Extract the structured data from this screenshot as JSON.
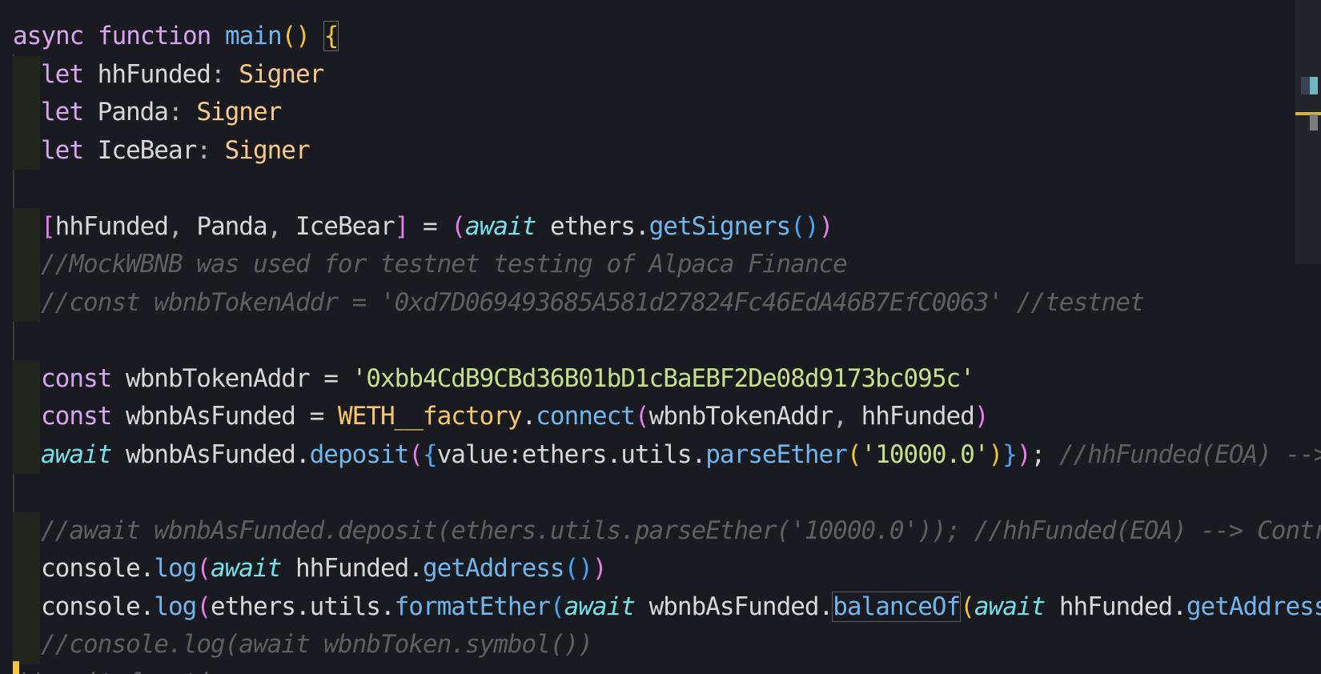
{
  "lines": [
    {
      "segments": [
        {
          "t": "async ",
          "c": "kw"
        },
        {
          "t": "function ",
          "c": "kw"
        },
        {
          "t": "main",
          "c": "fn"
        },
        {
          "t": "() ",
          "c": "b1"
        },
        {
          "t": "{",
          "c": "b1",
          "box": true
        }
      ]
    },
    {
      "ind": true,
      "segments": [
        {
          "t": "let ",
          "c": "kw"
        },
        {
          "t": "hhFunded",
          "c": "pl"
        },
        {
          "t": ": ",
          "c": "pm"
        },
        {
          "t": "Signer",
          "c": "ty"
        }
      ]
    },
    {
      "ind": true,
      "segments": [
        {
          "t": "let ",
          "c": "kw"
        },
        {
          "t": "Panda",
          "c": "pl"
        },
        {
          "t": ": ",
          "c": "pm"
        },
        {
          "t": "Signer",
          "c": "ty"
        }
      ]
    },
    {
      "ind": true,
      "segments": [
        {
          "t": "let ",
          "c": "kw"
        },
        {
          "t": "IceBear",
          "c": "pl"
        },
        {
          "t": ": ",
          "c": "pm"
        },
        {
          "t": "Signer",
          "c": "ty"
        }
      ]
    },
    {
      "blank": true,
      "segments": []
    },
    {
      "ind": true,
      "segments": [
        {
          "t": "[",
          "c": "b2"
        },
        {
          "t": "hhFunded",
          "c": "pl"
        },
        {
          "t": ", ",
          "c": "pm"
        },
        {
          "t": "Panda",
          "c": "pl"
        },
        {
          "t": ", ",
          "c": "pm"
        },
        {
          "t": "IceBear",
          "c": "pl"
        },
        {
          "t": "]",
          "c": "b2"
        },
        {
          "t": " = ",
          "c": "pl"
        },
        {
          "t": "(",
          "c": "b2"
        },
        {
          "t": "await",
          "c": "it"
        },
        {
          "t": " ethers.",
          "c": "pl"
        },
        {
          "t": "getSigners",
          "c": "fn"
        },
        {
          "t": "()",
          "c": "b3"
        },
        {
          "t": ")",
          "c": "b2"
        }
      ]
    },
    {
      "ind": true,
      "segments": [
        {
          "t": "//MockWBNB was used for testnet testing of Alpaca Finance",
          "c": "cm"
        }
      ]
    },
    {
      "ind": true,
      "segments": [
        {
          "t": "//const wbnbTokenAddr = '0xd7D069493685A581d27824Fc46EdA46B7EfC0063' //testnet",
          "c": "cm"
        }
      ]
    },
    {
      "blank": true,
      "segments": []
    },
    {
      "ind": true,
      "segments": [
        {
          "t": "const ",
          "c": "kw"
        },
        {
          "t": "wbnbTokenAddr",
          "c": "pl"
        },
        {
          "t": " = ",
          "c": "pl"
        },
        {
          "t": "'0xbb4CdB9CBd36B01bD1cBaEBF2De08d9173bc095c'",
          "c": "st"
        }
      ]
    },
    {
      "ind": true,
      "segments": [
        {
          "t": "const ",
          "c": "kw"
        },
        {
          "t": "wbnbAsFunded",
          "c": "pl"
        },
        {
          "t": " = ",
          "c": "pl"
        },
        {
          "t": "WETH__factory",
          "c": "cl"
        },
        {
          "t": ".",
          "c": "pl"
        },
        {
          "t": "connect",
          "c": "fn"
        },
        {
          "t": "(",
          "c": "b2"
        },
        {
          "t": "wbnbTokenAddr",
          "c": "pl"
        },
        {
          "t": ", ",
          "c": "pm"
        },
        {
          "t": "hhFunded",
          "c": "pl"
        },
        {
          "t": ")",
          "c": "b2"
        }
      ]
    },
    {
      "ind": true,
      "segments": [
        {
          "t": "await",
          "c": "it"
        },
        {
          "t": " wbnbAsFunded.",
          "c": "pl"
        },
        {
          "t": "deposit",
          "c": "fn"
        },
        {
          "t": "(",
          "c": "b2"
        },
        {
          "t": "{",
          "c": "b3"
        },
        {
          "t": "value:ethers.utils.",
          "c": "pl"
        },
        {
          "t": "parseEther",
          "c": "fn"
        },
        {
          "t": "(",
          "c": "b1"
        },
        {
          "t": "'10000.0'",
          "c": "st"
        },
        {
          "t": ")",
          "c": "b1"
        },
        {
          "t": "}",
          "c": "b3"
        },
        {
          "t": ")",
          "c": "b2"
        },
        {
          "t": "; ",
          "c": "pl"
        },
        {
          "t": "//hhFunded(EOA) --> Contract",
          "c": "cm"
        }
      ]
    },
    {
      "blank": true,
      "segments": []
    },
    {
      "ind": true,
      "segments": [
        {
          "t": "//await wbnbAsFunded.deposit(ethers.utils.parseEther('10000.0')); //hhFunded(EOA) --> Contract",
          "c": "cm"
        }
      ]
    },
    {
      "ind": true,
      "segments": [
        {
          "t": "console.",
          "c": "pl"
        },
        {
          "t": "log",
          "c": "fn"
        },
        {
          "t": "(",
          "c": "b2"
        },
        {
          "t": "await",
          "c": "it"
        },
        {
          "t": " hhFunded.",
          "c": "pl"
        },
        {
          "t": "getAddress",
          "c": "fn"
        },
        {
          "t": "()",
          "c": "b3"
        },
        {
          "t": ")",
          "c": "b2"
        }
      ]
    },
    {
      "ind": true,
      "segments": [
        {
          "t": "console.",
          "c": "pl"
        },
        {
          "t": "log",
          "c": "fn"
        },
        {
          "t": "(",
          "c": "b2"
        },
        {
          "t": "ethers.utils.",
          "c": "pl"
        },
        {
          "t": "formatEther",
          "c": "fn"
        },
        {
          "t": "(",
          "c": "b3"
        },
        {
          "t": "await",
          "c": "it"
        },
        {
          "t": " wbnbAsFunded.",
          "c": "pl"
        },
        {
          "t": "balanceOf",
          "c": "fn",
          "match": true
        },
        {
          "t": "(",
          "c": "b1"
        },
        {
          "t": "await",
          "c": "it"
        },
        {
          "t": " hhFunded.",
          "c": "pl"
        },
        {
          "t": "getAddress",
          "c": "fn"
        },
        {
          "t": "(",
          "c": "b2"
        }
      ]
    },
    {
      "ind": true,
      "segments": [
        {
          "t": "//console.log(await wbnbToken.symbol())",
          "c": "cm"
        }
      ]
    },
    {
      "ind": false,
      "segments": [
        {
          "t": "//await functi",
          "c": "cm"
        }
      ]
    }
  ],
  "icons": {
    "minimap": "minimap-overview",
    "cursor": "text-cursor-marker"
  },
  "colors": {
    "background": "#1a1b21",
    "keyword": "#d8a5f0",
    "function": "#6fb6ef",
    "type": "#f7c98a",
    "string": "#c6e08a",
    "comment": "#5e5f5f"
  }
}
